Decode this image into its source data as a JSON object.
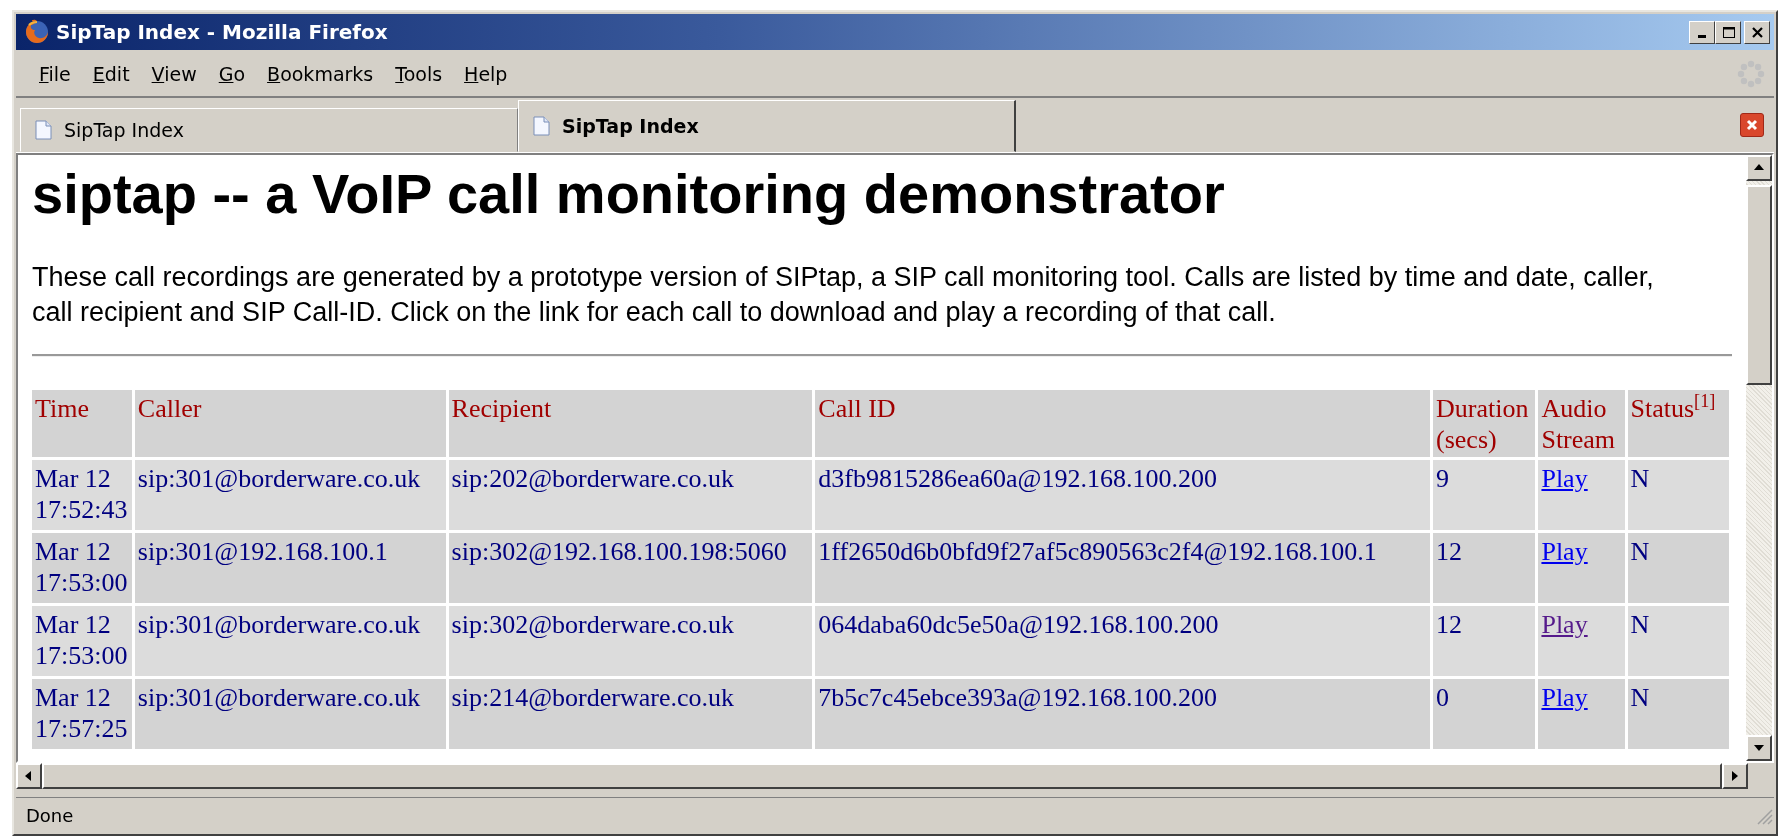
{
  "window": {
    "title": "SipTap Index - Mozilla Firefox"
  },
  "menu": [
    "File",
    "Edit",
    "View",
    "Go",
    "Bookmarks",
    "Tools",
    "Help"
  ],
  "tabs": [
    {
      "label": "SipTap Index",
      "selected": false
    },
    {
      "label": "SipTap Index",
      "selected": true
    }
  ],
  "page": {
    "heading": "siptap -- a VoIP call monitoring demonstrator",
    "intro": "These call recordings are generated by a prototype version of SIPtap, a SIP call monitoring tool. Calls are listed by time and date, caller, call recipient and SIP Call-ID. Click on the link for each call to download and play a recording of that call.",
    "table": {
      "columns": [
        "Time",
        "Caller",
        "Recipient",
        "Call ID",
        "Duration (secs)",
        "Audio Stream",
        "Status$^{[1]}$"
      ],
      "rows": [
        {
          "time": "Mar 12 17:52:43",
          "caller": "sip:301@borderware.co.uk",
          "recipient": "sip:202@borderware.co.uk",
          "call_id": "d3fb9815286ea60a@192.168.100.200",
          "duration": "9",
          "audio": {
            "label": "Play",
            "visited": false
          },
          "status": "N"
        },
        {
          "time": "Mar 12 17:53:00",
          "caller": "sip:301@192.168.100.1",
          "recipient": "sip:302@192.168.100.198:5060",
          "call_id": "1ff2650d6b0bfd9f27af5c890563c2f4@192.168.100.1",
          "duration": "12",
          "audio": {
            "label": "Play",
            "visited": false
          },
          "status": "N"
        },
        {
          "time": "Mar 12 17:53:00",
          "caller": "sip:301@borderware.co.uk",
          "recipient": "sip:302@borderware.co.uk",
          "call_id": "064daba60dc5e50a@192.168.100.200",
          "duration": "12",
          "audio": {
            "label": "Play",
            "visited": true
          },
          "status": "N"
        },
        {
          "time": "Mar 12 17:57:25",
          "caller": "sip:301@borderware.co.uk",
          "recipient": "sip:214@borderware.co.uk",
          "call_id": "7b5c7c45ebce393a@192.168.100.200",
          "duration": "0",
          "audio": {
            "label": "Play",
            "visited": false
          },
          "status": "N"
        }
      ]
    }
  },
  "status_bar": {
    "text": "Done"
  }
}
